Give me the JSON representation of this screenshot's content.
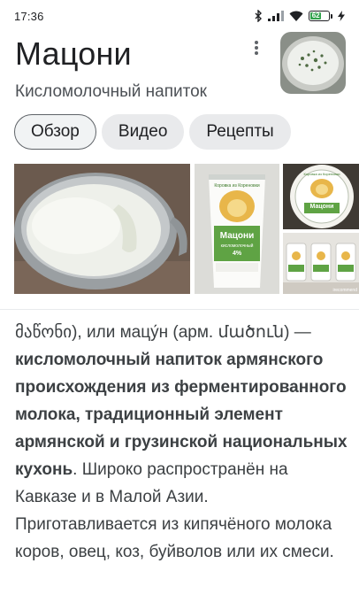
{
  "status": {
    "time": "17:36",
    "battery": "62"
  },
  "header": {
    "title": "Мацони",
    "subtitle": "Кисломолочный напиток"
  },
  "tabs": [
    {
      "label": "Обзор",
      "active": true
    },
    {
      "label": "Видео",
      "active": false
    },
    {
      "label": "Рецепты",
      "active": false
    }
  ],
  "images": {
    "main_alt": "bowl of matsoni",
    "bottle_brand": "Коровка из Кореновки",
    "bottle_name": "Мацони",
    "bottle_sub": "кисломолочный",
    "bottle_percent": "4%",
    "jar_brand": "Коровка из Кореновки",
    "jar_name": "Мацони",
    "watermark": "irecommend"
  },
  "article": {
    "intro": "მაწონი), или мацу́н (арм. մածուն)",
    "dash": "— ",
    "bold": "кисломолочный напиток армянского происхождения из ферментированного молока, традиционный элемент армянской и грузинской национальных кухонь",
    "rest": ". Широко распространён на Кавказе и в Малой Азии. Приготавливается из кипячёного молока коров, овец, коз, буйволов или их смеси."
  },
  "colors": {
    "accent": "#31a24c",
    "text": "#202124",
    "chip": "#e9eaec"
  }
}
